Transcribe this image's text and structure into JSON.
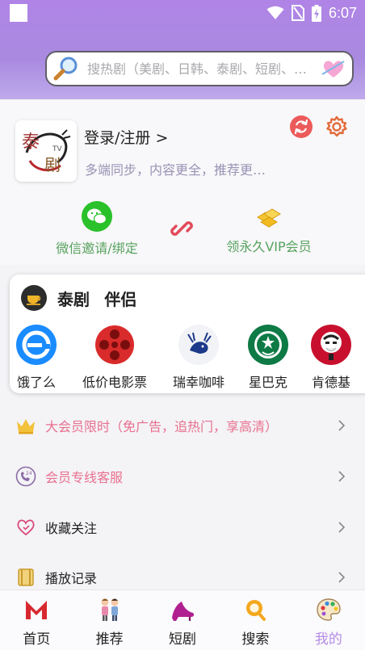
{
  "status_bar": {
    "time": "6:07"
  },
  "search": {
    "placeholder": "搜热剧（美剧、日韩、泰剧、短剧、…"
  },
  "profile": {
    "login_label": "登录/注册 >",
    "sub_label": "多端同步，内容更全，推荐更…",
    "wechat_label": "微信邀请/绑定",
    "vip_label": "领永久VIP会员",
    "accent_green": "#57a35f"
  },
  "partners": {
    "title": "泰剧ㅤ伴侣",
    "items": [
      {
        "label": "饿了么",
        "icon": "eleme-icon"
      },
      {
        "label": "低价电影票",
        "icon": "film-reel-icon"
      },
      {
        "label": "瑞幸咖啡",
        "icon": "luckin-deer-icon"
      },
      {
        "label": "星巴克",
        "icon": "starbucks-icon"
      },
      {
        "label": "肯德基",
        "icon": "kfc-icon"
      }
    ]
  },
  "menu": {
    "items": [
      {
        "label": "大会员限时（免广告，追热门，享高清）",
        "icon": "crown-icon",
        "color": "#e8708f"
      },
      {
        "label": "会员专线客服",
        "icon": "phone-24h-icon",
        "color": "#e8708f"
      },
      {
        "label": "收藏关注",
        "icon": "heart-outline-icon",
        "color": "#222222"
      },
      {
        "label": "播放记录",
        "icon": "film-history-icon",
        "color": "#222222"
      }
    ]
  },
  "nav": {
    "items": [
      {
        "label": "首页",
        "icon": "home-m-icon"
      },
      {
        "label": "推荐",
        "icon": "couple-icon"
      },
      {
        "label": "短剧",
        "icon": "high-heel-icon"
      },
      {
        "label": "搜索",
        "icon": "search-icon"
      },
      {
        "label": "我的",
        "icon": "palette-icon",
        "active": true
      }
    ],
    "active_color": "#b48de6"
  }
}
